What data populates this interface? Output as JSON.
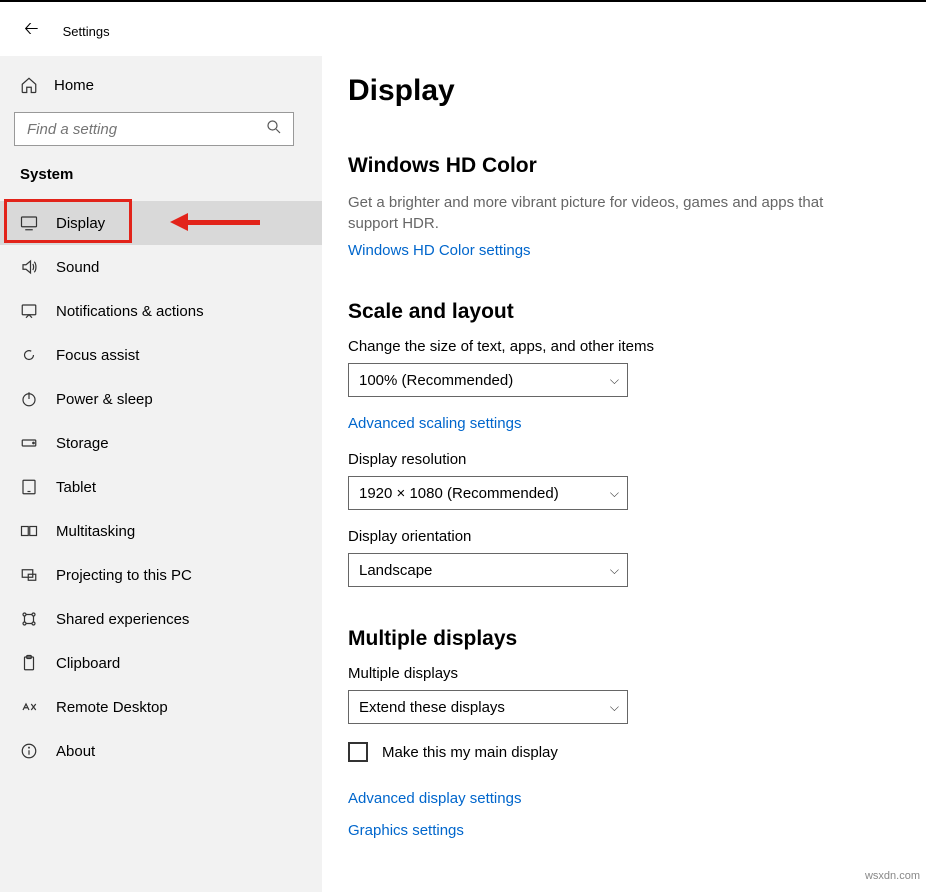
{
  "app_title": "Settings",
  "home_label": "Home",
  "search_placeholder": "Find a setting",
  "section_label": "System",
  "nav": [
    {
      "id": "display",
      "label": "Display",
      "selected": true
    },
    {
      "id": "sound",
      "label": "Sound",
      "selected": false
    },
    {
      "id": "notifications",
      "label": "Notifications & actions",
      "selected": false
    },
    {
      "id": "focus-assist",
      "label": "Focus assist",
      "selected": false
    },
    {
      "id": "power-sleep",
      "label": "Power & sleep",
      "selected": false
    },
    {
      "id": "storage",
      "label": "Storage",
      "selected": false
    },
    {
      "id": "tablet",
      "label": "Tablet",
      "selected": false
    },
    {
      "id": "multitasking",
      "label": "Multitasking",
      "selected": false
    },
    {
      "id": "projecting",
      "label": "Projecting to this PC",
      "selected": false
    },
    {
      "id": "shared-exp",
      "label": "Shared experiences",
      "selected": false
    },
    {
      "id": "clipboard",
      "label": "Clipboard",
      "selected": false
    },
    {
      "id": "remote-desktop",
      "label": "Remote Desktop",
      "selected": false
    },
    {
      "id": "about",
      "label": "About",
      "selected": false
    }
  ],
  "page_title": "Display",
  "hdr": {
    "heading": "Windows HD Color",
    "desc": "Get a brighter and more vibrant picture for videos, games and apps that support HDR.",
    "link": "Windows HD Color settings"
  },
  "scale": {
    "heading": "Scale and layout",
    "size_label": "Change the size of text, apps, and other items",
    "size_value": "100% (Recommended)",
    "adv_link": "Advanced scaling settings",
    "res_label": "Display resolution",
    "res_value": "1920 × 1080 (Recommended)",
    "orient_label": "Display orientation",
    "orient_value": "Landscape"
  },
  "multi": {
    "heading": "Multiple displays",
    "label": "Multiple displays",
    "value": "Extend these displays",
    "checkbox_label": "Make this my main display",
    "adv_link": "Advanced display settings",
    "gfx_link": "Graphics settings"
  },
  "watermark": "wsxdn.com"
}
